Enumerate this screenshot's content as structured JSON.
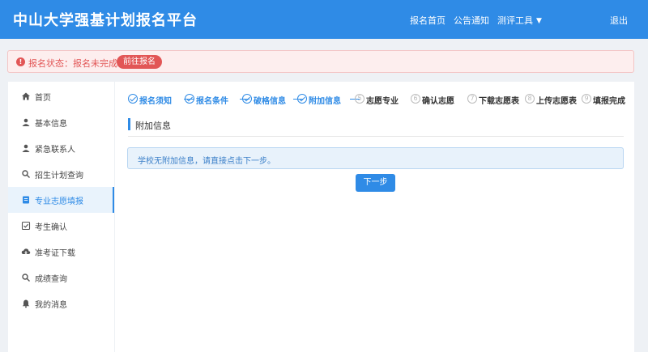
{
  "header": {
    "title": "中山大学强基计划报名平台",
    "nav": [
      "报名首页",
      "公告通知",
      "测评工具"
    ],
    "logout": "退出"
  },
  "alert": {
    "message": "报名状态：报名未完成",
    "button": "前往报名"
  },
  "sidebar": {
    "items": [
      {
        "label": "首页",
        "icon": "home-icon"
      },
      {
        "label": "基本信息",
        "icon": "user-icon"
      },
      {
        "label": "紧急联系人",
        "icon": "user-icon"
      },
      {
        "label": "招生计划查询",
        "icon": "search-icon"
      },
      {
        "label": "专业志愿填报",
        "icon": "document-icon",
        "active": true
      },
      {
        "label": "考生确认",
        "icon": "checkbox-icon"
      },
      {
        "label": "准考证下载",
        "icon": "cloud-download-icon"
      },
      {
        "label": "成绩查询",
        "icon": "search-icon"
      },
      {
        "label": "我的消息",
        "icon": "bell-icon"
      }
    ]
  },
  "steps": [
    {
      "label": "报名须知",
      "status": "done"
    },
    {
      "label": "报名条件",
      "status": "done"
    },
    {
      "label": "破格信息",
      "status": "done"
    },
    {
      "label": "附加信息",
      "status": "done"
    },
    {
      "label": "志愿专业",
      "status": "todo",
      "number": "5"
    },
    {
      "label": "确认志愿",
      "status": "todo",
      "number": "6"
    },
    {
      "label": "下载志愿表",
      "status": "todo",
      "number": "7"
    },
    {
      "label": "上传志愿表",
      "status": "todo",
      "number": "8"
    },
    {
      "label": "填报完成",
      "status": "todo",
      "number": "9"
    }
  ],
  "content": {
    "section_title": "附加信息",
    "info_text": "学校无附加信息，请直接点击下一步。",
    "next_button": "下一步"
  },
  "colors": {
    "primary": "#2f8be6",
    "danger": "#e25656",
    "sidebar_active_bg": "#e9f3fc"
  }
}
